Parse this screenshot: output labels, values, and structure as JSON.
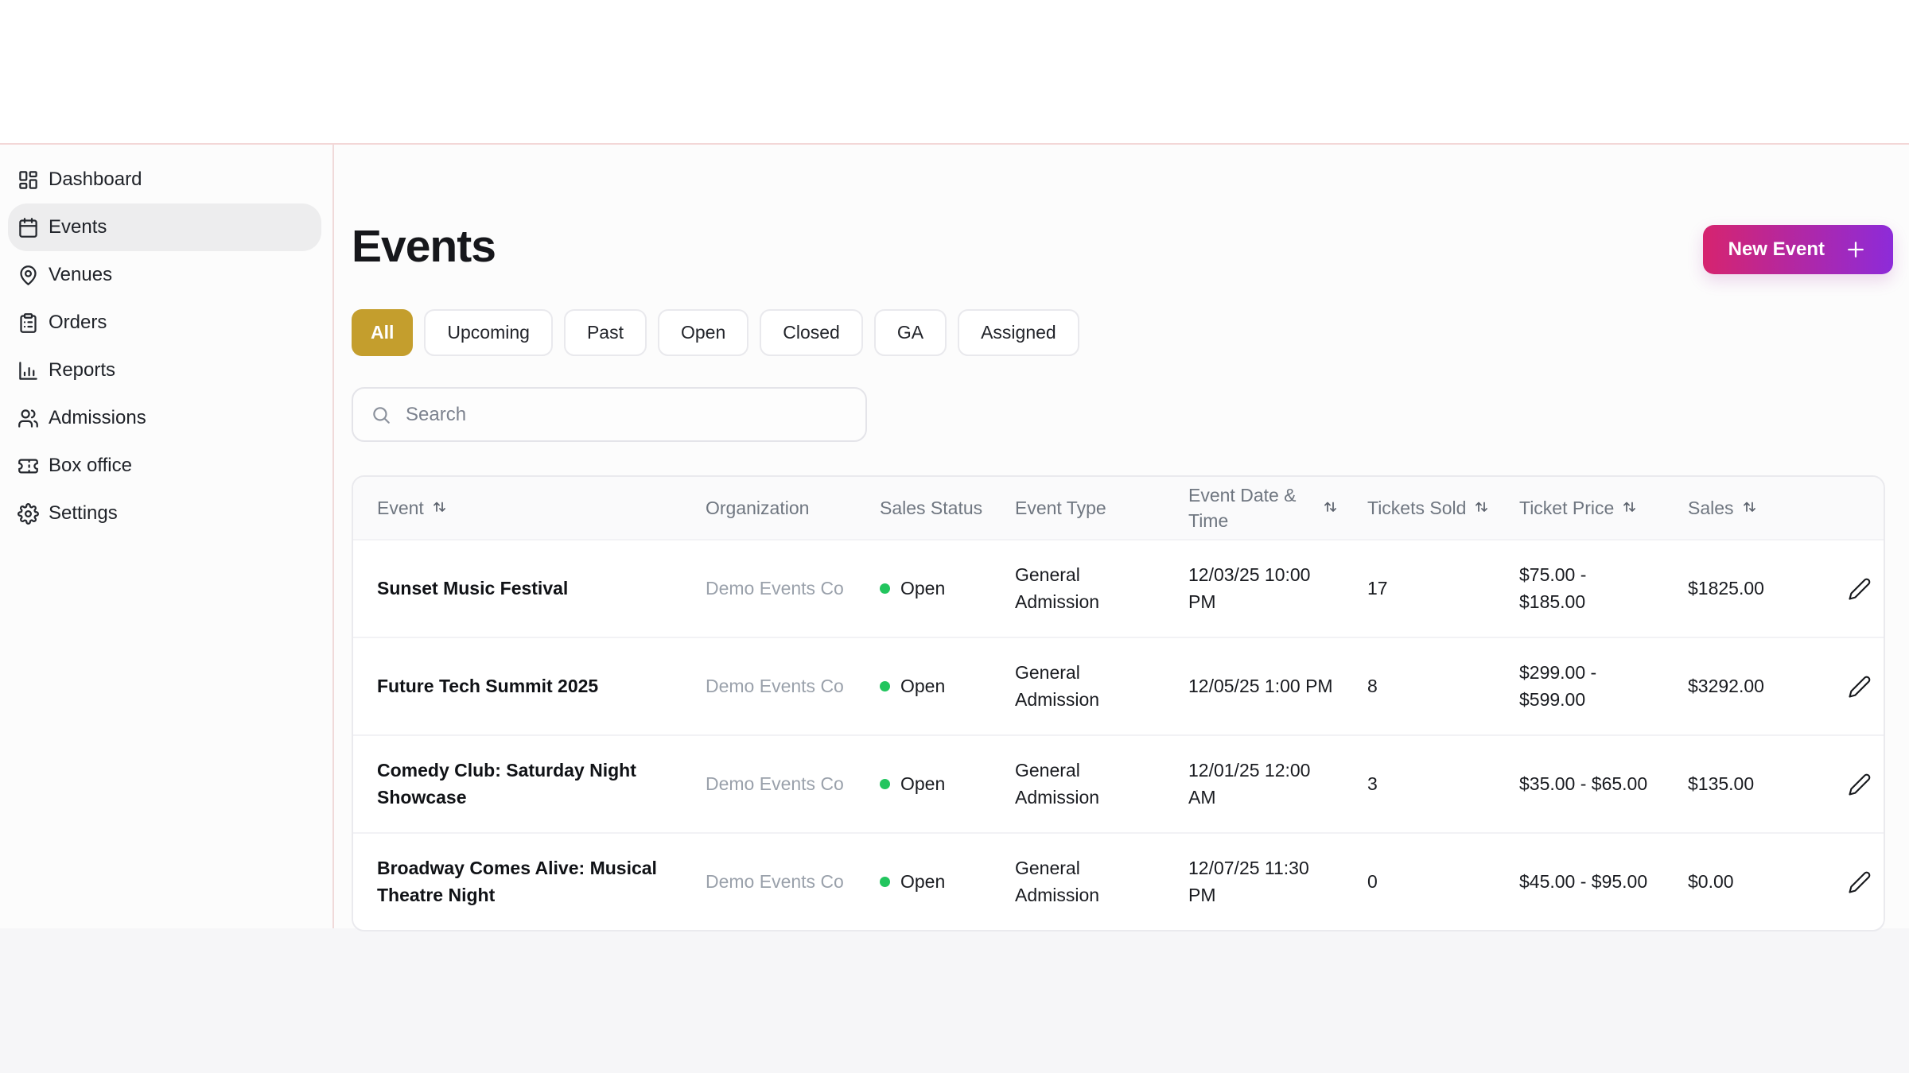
{
  "sidebar": {
    "items": [
      {
        "label": "Dashboard",
        "icon": "layout-dashboard-icon",
        "active": false
      },
      {
        "label": "Events",
        "icon": "calendar-icon",
        "active": true
      },
      {
        "label": "Venues",
        "icon": "map-pin-icon",
        "active": false
      },
      {
        "label": "Orders",
        "icon": "clipboard-list-icon",
        "active": false
      },
      {
        "label": "Reports",
        "icon": "bar-chart-icon",
        "active": false
      },
      {
        "label": "Admissions",
        "icon": "users-icon",
        "active": false
      },
      {
        "label": "Box office",
        "icon": "ticket-icon",
        "active": false
      },
      {
        "label": "Settings",
        "icon": "gear-icon",
        "active": false
      }
    ]
  },
  "header": {
    "title": "Events",
    "new_event": {
      "label": "New Event",
      "icon": "plus-icon"
    }
  },
  "filters": {
    "active": "All",
    "items": [
      "All",
      "Upcoming",
      "Past",
      "Open",
      "Closed",
      "GA",
      "Assigned"
    ]
  },
  "search": {
    "placeholder": "Search",
    "icon": "search-icon"
  },
  "table": {
    "columns": [
      {
        "label": "Event",
        "sortable": true
      },
      {
        "label": "Organization",
        "sortable": false
      },
      {
        "label": "Sales Status",
        "sortable": false
      },
      {
        "label": "Event Type",
        "sortable": false
      },
      {
        "label": "Event Date & Time",
        "sortable": true
      },
      {
        "label": "Tickets Sold",
        "sortable": true
      },
      {
        "label": "Ticket Price",
        "sortable": true
      },
      {
        "label": "Sales",
        "sortable": true
      }
    ],
    "row_action_icon": "pencil-icon",
    "rows": [
      {
        "event": "Sunset Music Festival",
        "organization": "Demo Events Co",
        "sales_status": "Open",
        "event_type": "General Admission",
        "event_datetime": "12/03/25 10:00 PM",
        "tickets_sold": "17",
        "ticket_price": "$75.00 - $185.00",
        "sales": "$1825.00"
      },
      {
        "event": "Future Tech Summit 2025",
        "organization": "Demo Events Co",
        "sales_status": "Open",
        "event_type": "General Admission",
        "event_datetime": "12/05/25 1:00 PM",
        "tickets_sold": "8",
        "ticket_price": "$299.00 - $599.00",
        "sales": "$3292.00"
      },
      {
        "event": "Comedy Club: Saturday Night Showcase",
        "organization": "Demo Events Co",
        "sales_status": "Open",
        "event_type": "General Admission",
        "event_datetime": "12/01/25 12:00 AM",
        "tickets_sold": "3",
        "ticket_price": "$35.00 - $65.00",
        "sales": "$135.00"
      },
      {
        "event": "Broadway Comes Alive: Musical Theatre Night",
        "organization": "Demo Events Co",
        "sales_status": "Open",
        "event_type": "General Admission",
        "event_datetime": "12/07/25 11:30 PM",
        "tickets_sold": "0",
        "ticket_price": "$45.00 - $95.00",
        "sales": "$0.00"
      }
    ]
  },
  "colors": {
    "accent_gradient_start": "#d6246f",
    "accent_gradient_end": "#8d2bd9",
    "filter_active_bg": "#c49e2d",
    "status_open_dot": "#22c55e",
    "divider_pink": "#f3d7d7"
  }
}
